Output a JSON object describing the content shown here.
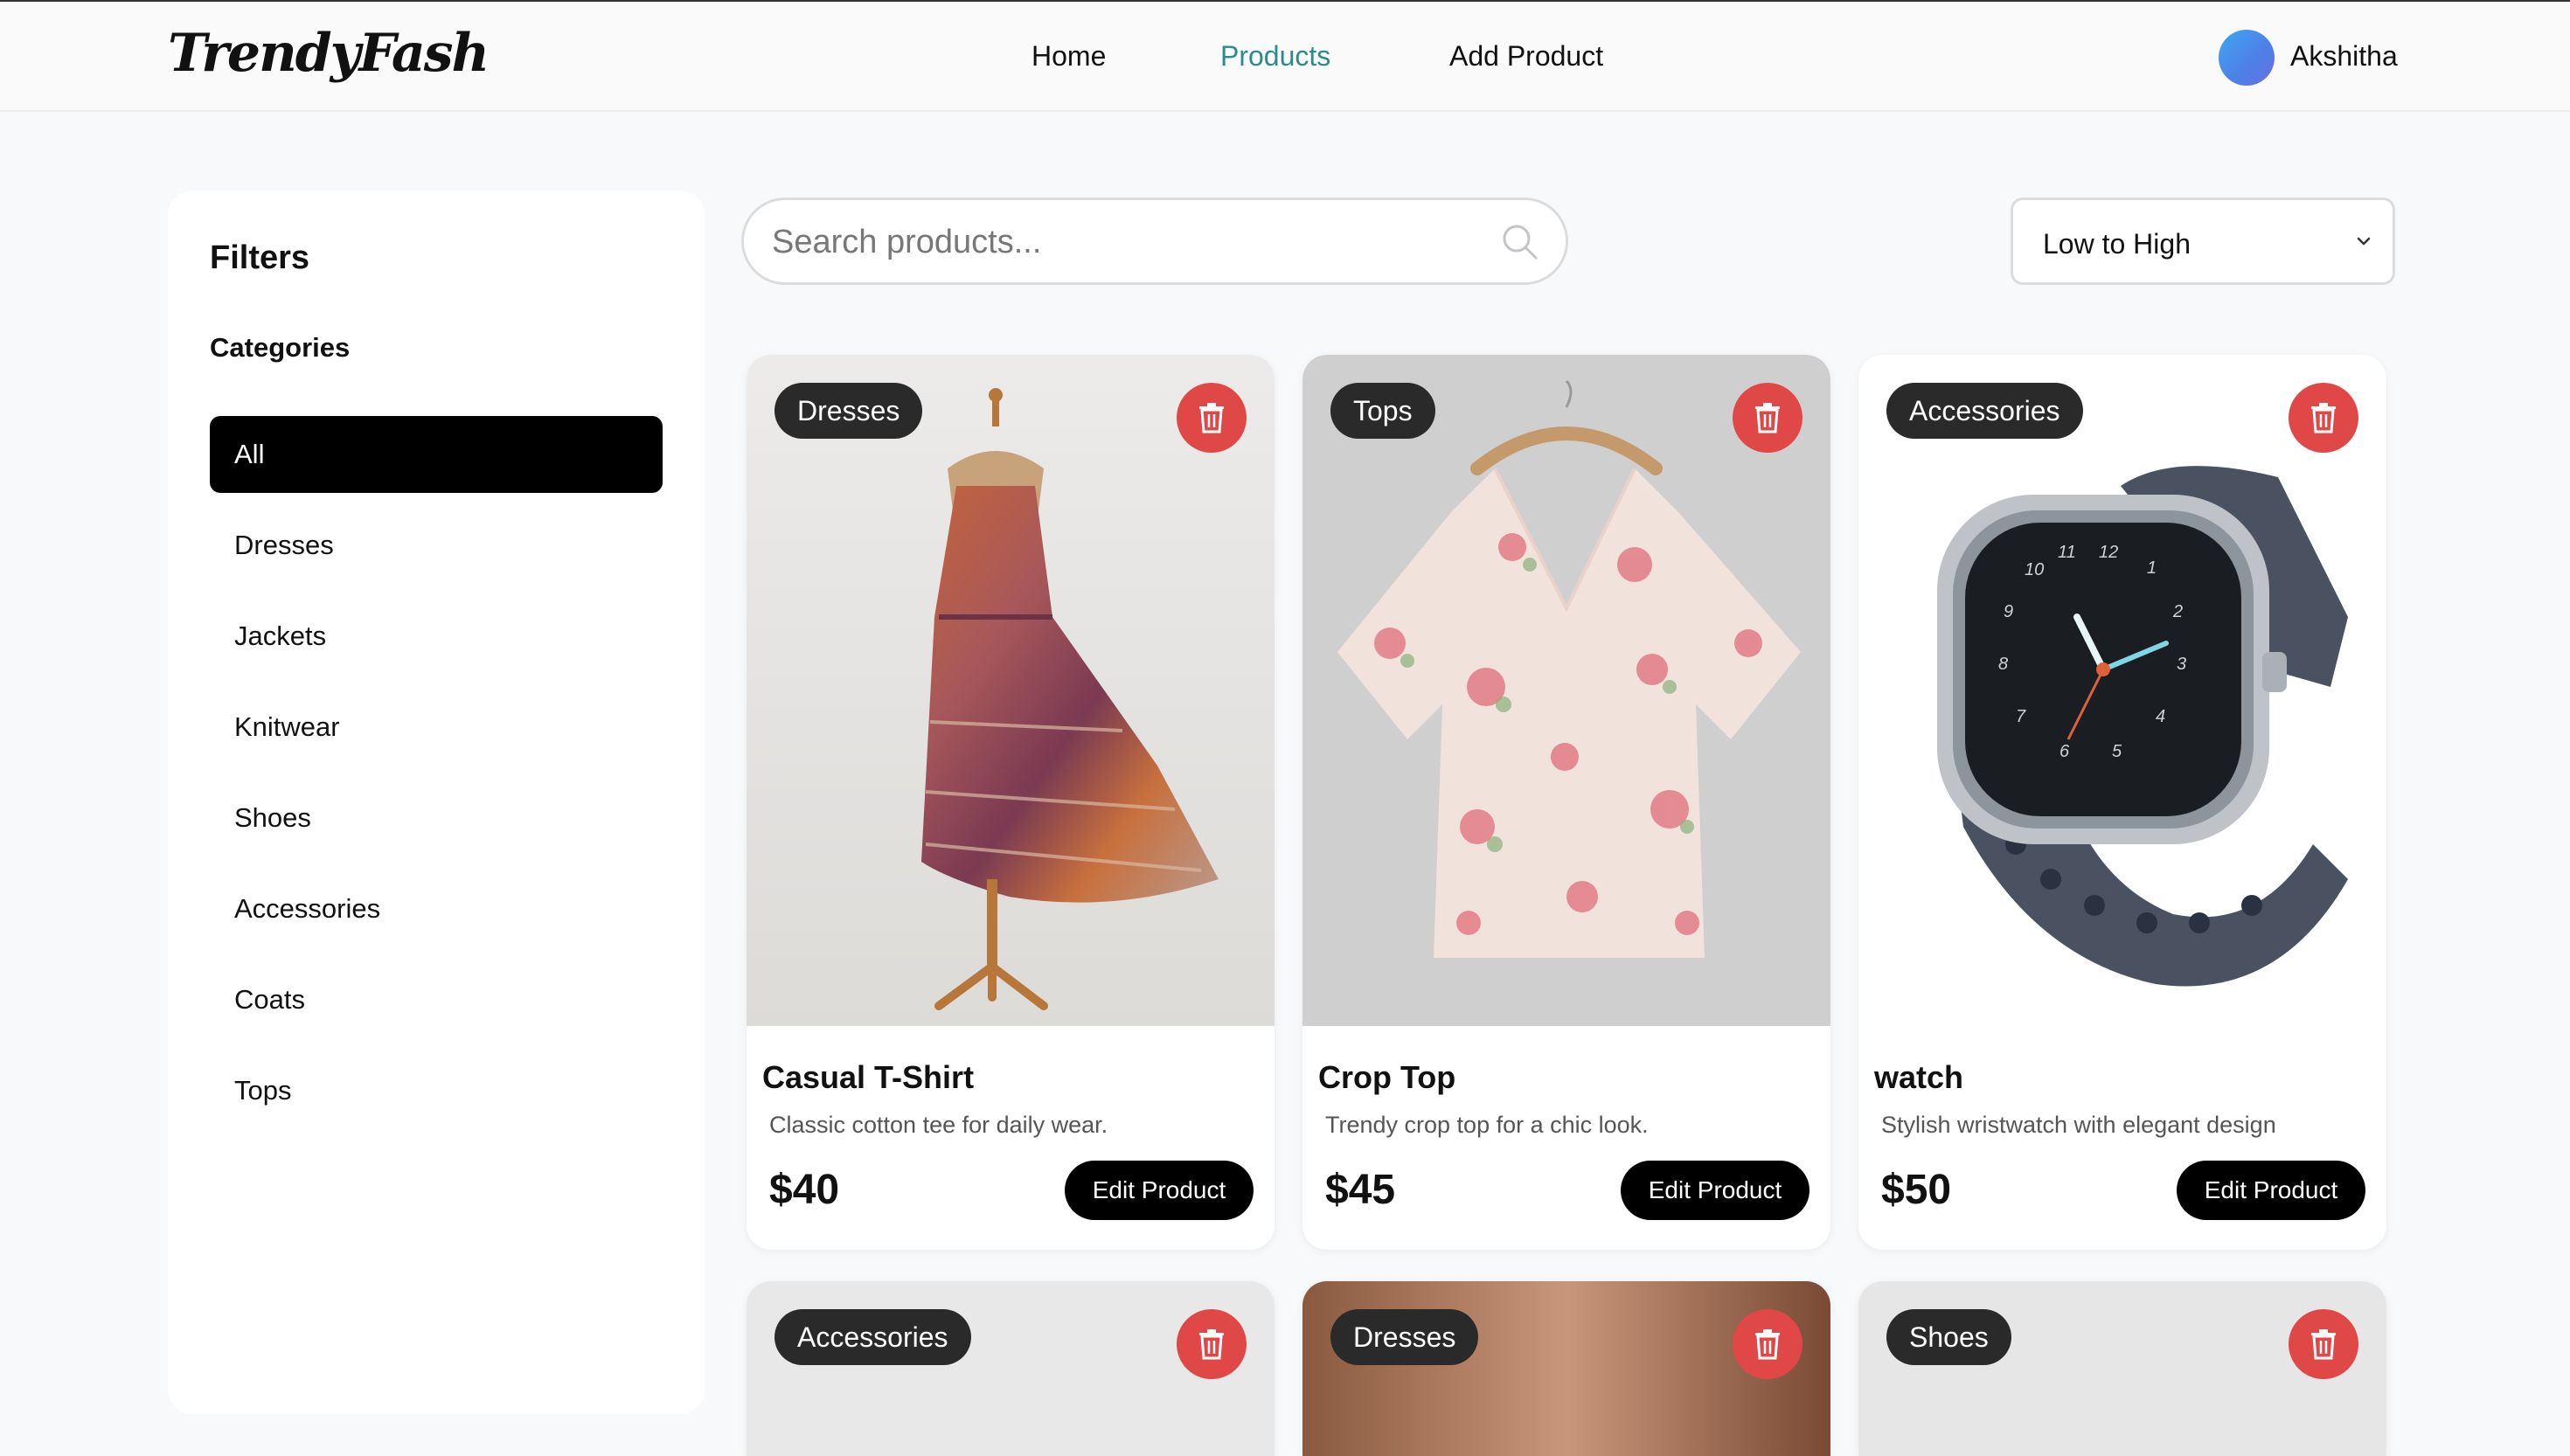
{
  "brand": "TrendyFash",
  "nav": {
    "home": "Home",
    "products": "Products",
    "add_product": "Add Product",
    "active_color": "#2c8b8b"
  },
  "user": {
    "name": "Akshitha"
  },
  "sidebar": {
    "title": "Filters",
    "categories_title": "Categories",
    "categories": [
      "All",
      "Dresses",
      "Jackets",
      "Knitwear",
      "Shoes",
      "Accessories",
      "Coats",
      "Tops"
    ],
    "active": "All"
  },
  "search": {
    "placeholder": "Search products...",
    "value": ""
  },
  "sort": {
    "selected": "Low to High"
  },
  "products": [
    {
      "category": "Dresses",
      "name": "Casual T-Shirt",
      "description": "Classic cotton tee for daily wear.",
      "price": "$40",
      "action": "Edit Product"
    },
    {
      "category": "Tops",
      "name": "Crop Top",
      "description": "Trendy crop top for a chic look.",
      "price": "$45",
      "action": "Edit Product"
    },
    {
      "category": "Accessories",
      "name": "watch",
      "description": "Stylish wristwatch with elegant design",
      "price": "$50",
      "action": "Edit Product"
    },
    {
      "category": "Accessories"
    },
    {
      "category": "Dresses"
    },
    {
      "category": "Shoes"
    }
  ],
  "colors": {
    "delete": "#e04848",
    "badge": "#2a2a2a",
    "primary_button": "#000000"
  },
  "icons": {
    "search": "search-icon",
    "sort": "chevron-down-icon",
    "delete": "trash-icon"
  }
}
